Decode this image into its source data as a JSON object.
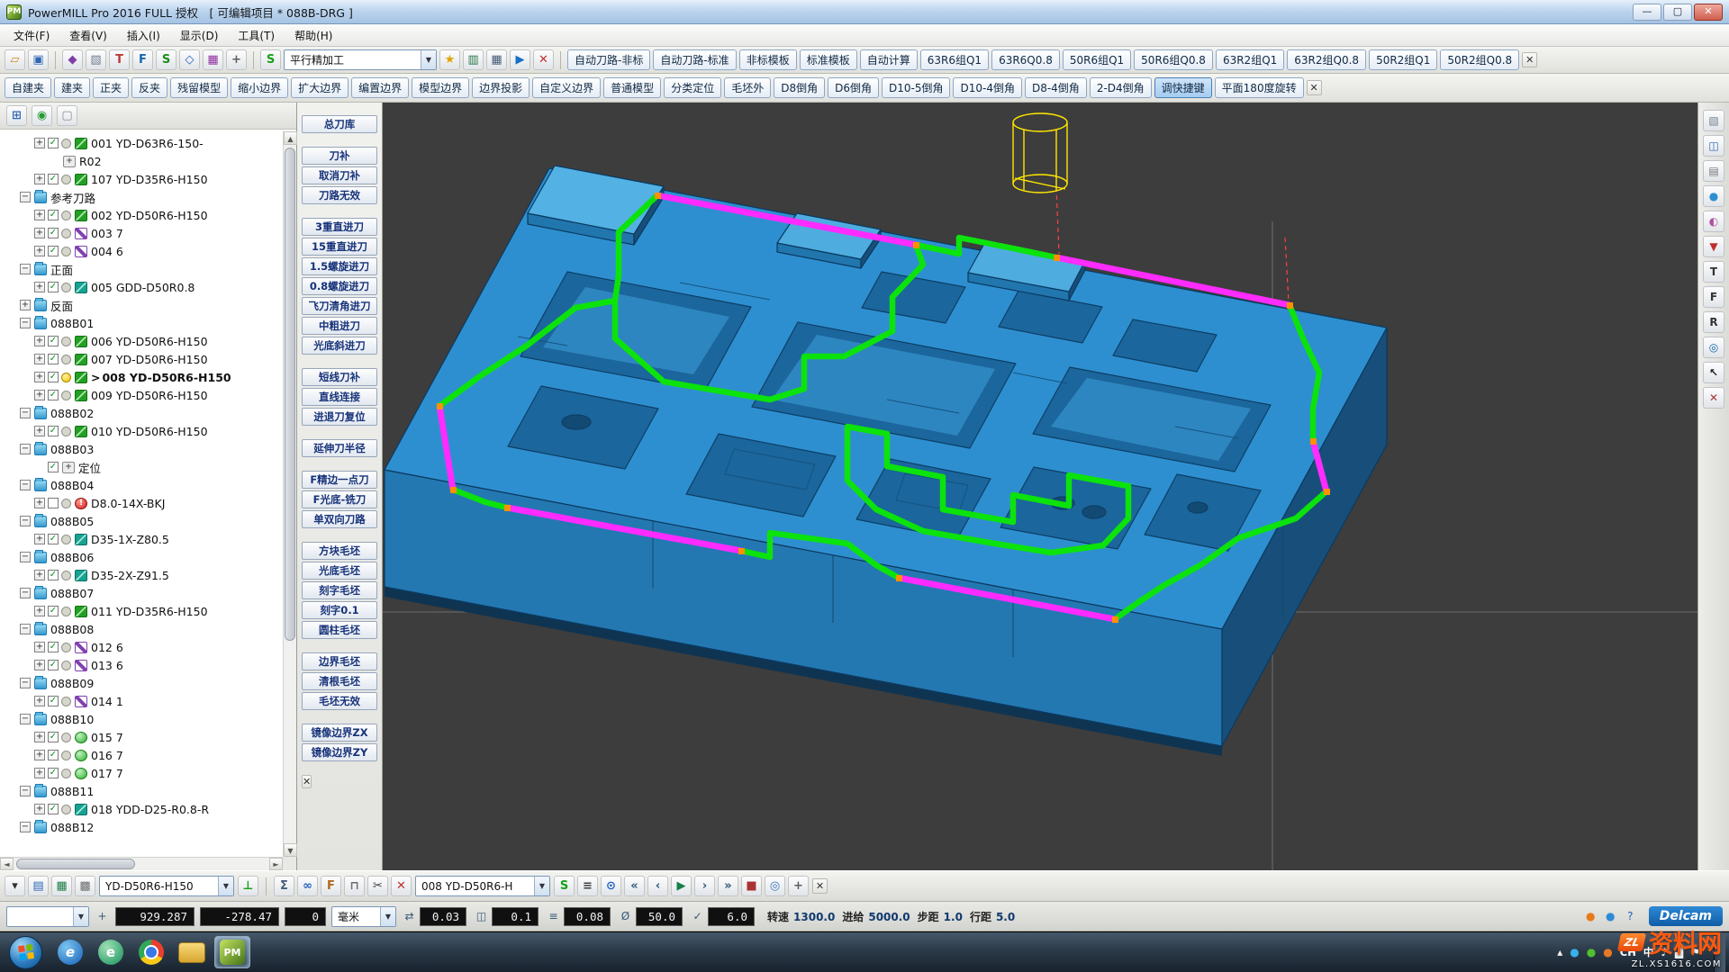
{
  "window": {
    "title": "PowerMILL Pro 2016 FULL 授权　[ 可编辑项目 * 088B-DRG ]",
    "app_badge": "PM",
    "min": "—",
    "max": "▢",
    "close": "✕"
  },
  "menu": {
    "items": [
      "文件(F)",
      "查看(V)",
      "插入(I)",
      "显示(D)",
      "工具(T)",
      "帮助(H)"
    ]
  },
  "toolbar1": {
    "icons_left": [
      {
        "name": "open-project-icon",
        "glyph": "▱",
        "color": "#d08a18"
      },
      {
        "name": "save-project-icon",
        "glyph": "▣",
        "color": "#2f67b5"
      },
      {
        "name": "sep"
      },
      {
        "name": "models-icon",
        "glyph": "◆",
        "color": "#7f3fa6"
      },
      {
        "name": "block-icon",
        "glyph": "▧",
        "color": "#6e7e8e"
      },
      {
        "name": "tool-icon",
        "glyph": "T",
        "color": "#bf3838"
      },
      {
        "name": "feeds-icon",
        "glyph": "F",
        "color": "#1767ae"
      },
      {
        "name": "toolpath-icon",
        "glyph": "S",
        "color": "#1a8f1a"
      },
      {
        "name": "boundary-icon",
        "glyph": "◇",
        "color": "#1f5fbe"
      },
      {
        "name": "pattern-icon",
        "glyph": "▦",
        "color": "#8f2f9f"
      },
      {
        "name": "workplane-icon",
        "glyph": "+",
        "color": "#5e5e5e"
      },
      {
        "name": "sep"
      },
      {
        "name": "strategy-icon",
        "glyph": "S",
        "color": "#18a018"
      }
    ],
    "strategy_combo": "平行精加工",
    "icons_right": [
      {
        "name": "wizard-icon",
        "glyph": "★",
        "color": "#e2a300"
      },
      {
        "name": "nc-program-icon",
        "glyph": "▥",
        "color": "#277546"
      },
      {
        "name": "calculator-icon",
        "glyph": "▦",
        "color": "#455d75"
      },
      {
        "name": "simulate-icon",
        "glyph": "▶",
        "color": "#176fc6"
      },
      {
        "name": "collision-check-icon",
        "glyph": "✕",
        "color": "#bf3030"
      },
      {
        "name": "sep"
      }
    ],
    "macro_buttons": [
      "自动刀路-非标",
      "自动刀路-标准",
      "非标模板",
      "标准模板",
      "自动计算",
      "63R6组Q1",
      "63R6Q0.8",
      "50R6组Q1",
      "50R6组Q0.8",
      "63R2组Q1",
      "63R2组Q0.8",
      "50R2组Q1",
      "50R2组Q0.8"
    ],
    "close": "✕"
  },
  "toolbar2": {
    "buttons": [
      "自建夹",
      "建夹",
      "正夹",
      "反夹",
      "残留模型",
      "缩小边界",
      "扩大边界",
      "编置边界",
      "模型边界",
      "边界投影",
      "自定义边界",
      "普通模型",
      "分类定位",
      "毛坯外",
      "D8倒角",
      "D6倒角",
      "D10-5倒角",
      "D10-4倒角",
      "D8-4倒角",
      "2-D4倒角",
      "调快捷键",
      "平面180度旋转"
    ],
    "active_index": 20,
    "close": "✕"
  },
  "explorer": {
    "toolbar": [
      {
        "name": "tree-view-icon",
        "glyph": "⊞",
        "color": "#2f67b5"
      },
      {
        "name": "world-icon",
        "glyph": "◉",
        "color": "#279a38"
      },
      {
        "name": "filter-icon",
        "glyph": "▢",
        "color": "#8a8a8a"
      }
    ],
    "items": [
      {
        "level": 2,
        "exp": "plus",
        "check": true,
        "bulb": "off",
        "icon": "toolpath-green",
        "label": "001 YD-D63R6-150-"
      },
      {
        "level": 3,
        "icon": "workplane",
        "label": "R02"
      },
      {
        "level": 2,
        "exp": "plus",
        "check": true,
        "bulb": "off",
        "icon": "toolpath-green",
        "label": "107 YD-D35R6-H150"
      },
      {
        "level": 1,
        "exp": "minus",
        "icon": "folder",
        "label": "参考刀路"
      },
      {
        "level": 2,
        "exp": "plus",
        "check": true,
        "bulb": "off",
        "icon": "toolpath-green",
        "label": "002 YD-D50R6-H150"
      },
      {
        "level": 2,
        "exp": "plus",
        "check": true,
        "bulb": "off",
        "icon": "pattern",
        "label": "003 7"
      },
      {
        "level": 2,
        "exp": "plus",
        "check": true,
        "bulb": "off",
        "icon": "pattern",
        "label": "004 6"
      },
      {
        "level": 1,
        "exp": "minus",
        "icon": "folder",
        "label": "正面"
      },
      {
        "level": 2,
        "exp": "plus",
        "check": true,
        "bulb": "off",
        "icon": "toolpath-teal",
        "label": "005 GDD-D50R0.8"
      },
      {
        "level": 1,
        "exp": "plus",
        "icon": "folder",
        "label": "反面"
      },
      {
        "level": 1,
        "exp": "minus",
        "icon": "folder",
        "label": "088B01"
      },
      {
        "level": 2,
        "exp": "plus",
        "check": true,
        "bulb": "off",
        "icon": "toolpath-green",
        "label": "006 YD-D50R6-H150"
      },
      {
        "level": 2,
        "exp": "plus",
        "check": true,
        "bulb": "off",
        "icon": "toolpath-green",
        "label": "007 YD-D50R6-H150"
      },
      {
        "level": 2,
        "exp": "plus",
        "check": true,
        "bulb": "on",
        "icon": "toolpath-green",
        "label": "008 YD-D50R6-H150",
        "bold": true,
        "prefix": ">"
      },
      {
        "level": 2,
        "exp": "plus",
        "check": true,
        "bulb": "off",
        "icon": "toolpath-green",
        "label": "009 YD-D50R6-H150"
      },
      {
        "level": 1,
        "exp": "minus",
        "icon": "folder",
        "label": "088B02"
      },
      {
        "level": 2,
        "exp": "plus",
        "check": true,
        "bulb": "off",
        "icon": "toolpath-green",
        "label": "010 YD-D50R6-H150"
      },
      {
        "level": 1,
        "exp": "minus",
        "icon": "folder",
        "label": "088B03"
      },
      {
        "level": 2,
        "check": true,
        "icon": "workplane",
        "label": "定位"
      },
      {
        "level": 1,
        "exp": "minus",
        "icon": "folder",
        "label": "088B04"
      },
      {
        "level": 2,
        "exp": "plus",
        "check": false,
        "bulb": "off",
        "icon": "error",
        "label": "D8.0-14X-BKJ"
      },
      {
        "level": 1,
        "exp": "minus",
        "icon": "folder",
        "label": "088B05"
      },
      {
        "level": 2,
        "exp": "plus",
        "check": true,
        "bulb": "off",
        "icon": "toolpath-teal",
        "label": "D35-1X-Z80.5"
      },
      {
        "level": 1,
        "exp": "minus",
        "icon": "folder",
        "label": "088B06"
      },
      {
        "level": 2,
        "exp": "plus",
        "check": true,
        "bulb": "off",
        "icon": "toolpath-teal",
        "label": "D35-2X-Z91.5"
      },
      {
        "level": 1,
        "exp": "minus",
        "icon": "folder",
        "label": "088B07"
      },
      {
        "level": 2,
        "exp": "plus",
        "check": true,
        "bulb": "off",
        "icon": "toolpath-green",
        "label": "011 YD-D35R6-H150"
      },
      {
        "level": 1,
        "exp": "minus",
        "icon": "folder",
        "label": "088B08"
      },
      {
        "level": 2,
        "exp": "plus",
        "check": true,
        "bulb": "off",
        "icon": "pattern",
        "label": "012 6"
      },
      {
        "level": 2,
        "exp": "plus",
        "check": true,
        "bulb": "off",
        "icon": "pattern",
        "label": "013 6"
      },
      {
        "level": 1,
        "exp": "minus",
        "icon": "folder",
        "label": "088B09"
      },
      {
        "level": 2,
        "exp": "plus",
        "check": true,
        "bulb": "off",
        "icon": "pattern",
        "label": "014 1"
      },
      {
        "level": 1,
        "exp": "minus",
        "icon": "folder",
        "label": "088B10"
      },
      {
        "level": 2,
        "exp": "plus",
        "check": true,
        "bulb": "off",
        "icon": "boundary",
        "label": "015 7"
      },
      {
        "level": 2,
        "exp": "plus",
        "check": true,
        "bulb": "off",
        "icon": "boundary",
        "label": "016 7"
      },
      {
        "level": 2,
        "exp": "plus",
        "check": true,
        "bulb": "off",
        "icon": "boundary",
        "label": "017 7"
      },
      {
        "level": 1,
        "exp": "minus",
        "icon": "folder",
        "label": "088B11"
      },
      {
        "level": 2,
        "exp": "plus",
        "check": true,
        "bulb": "off",
        "icon": "toolpath-teal",
        "label": "018 YDD-D25-R0.8-R"
      },
      {
        "level": 1,
        "exp": "minus",
        "icon": "folder",
        "label": "088B12"
      }
    ]
  },
  "macro_panel": {
    "groups": [
      [
        "总刀库"
      ],
      [
        "刀补",
        "取消刀补",
        "刀路无效"
      ],
      [
        "3重直进刀",
        "15重直进刀",
        "1.5螺旋进刀",
        "0.8螺旋进刀",
        "飞刀清角进刀",
        "中粗进刀",
        "光底斜进刀"
      ],
      [
        "短线刀补",
        "直线连接",
        "进退刀复位"
      ],
      [
        "延伸刀半径"
      ],
      [
        "F精边一点刀",
        "F光底-铣刀",
        "单双向刀路"
      ],
      [
        "方块毛坯",
        "光底毛坯",
        "刻字毛坯",
        "刻字0.1",
        "圆柱毛坯"
      ],
      [
        "边界毛坯",
        "清根毛坯",
        "毛坯无效"
      ],
      [
        "镜像边界ZX",
        "镜像边界ZY"
      ]
    ],
    "close": "✕"
  },
  "right_toolbar": {
    "icons": [
      {
        "name": "block-view-icon",
        "glyph": "▧",
        "color": "#6e7e8e"
      },
      {
        "name": "iso-view-icon",
        "glyph": "◫",
        "color": "#2f67b5"
      },
      {
        "name": "wireframe-view-icon",
        "glyph": "▤",
        "color": "#777"
      },
      {
        "name": "shaded-view-icon",
        "glyph": "●",
        "color": "#2e8fd0"
      },
      {
        "name": "rainbow-view-icon",
        "glyph": "◐",
        "color": "#b04fa0"
      },
      {
        "name": "gouge-view-icon",
        "glyph": "▼",
        "color": "#bf3030"
      },
      {
        "name": "top-view-icon",
        "glyph": "T",
        "color": "#333"
      },
      {
        "name": "front-view-icon",
        "glyph": "F",
        "color": "#333"
      },
      {
        "name": "right-view-icon",
        "glyph": "R",
        "color": "#333"
      },
      {
        "name": "zoom-fit-icon",
        "glyph": "◎",
        "color": "#1767ae"
      },
      {
        "name": "cursor-icon",
        "glyph": "↖",
        "color": "#222"
      },
      {
        "name": "close-right-toolbar-icon",
        "glyph": "✕",
        "color": "#a33"
      }
    ]
  },
  "bottom_toolbar": {
    "left_icons": [
      {
        "name": "display-options-icon",
        "glyph": "▾",
        "color": "#303030"
      },
      {
        "name": "levels-icon",
        "glyph": "▤",
        "color": "#2f67b5"
      },
      {
        "name": "named-views-icon",
        "glyph": "▦",
        "color": "#1f7f48"
      },
      {
        "name": "grid-icon",
        "glyph": "▩",
        "color": "#6e6e6e"
      }
    ],
    "tool_combo": "YD-D50R6-H150",
    "tool_icons": [
      {
        "name": "active-tool-icon",
        "glyph": "⊥",
        "color": "#18a018"
      }
    ],
    "mid_icons": [
      {
        "name": "toolpath-stats-icon",
        "glyph": "Σ",
        "color": "#455d75"
      },
      {
        "name": "leads-links-icon",
        "glyph": "∞",
        "color": "#1f5fbe"
      },
      {
        "name": "feeds-speeds-icon",
        "glyph": "F",
        "color": "#b06818"
      },
      {
        "name": "holder-icon",
        "glyph": "⊓",
        "color": "#6e6e6e"
      },
      {
        "name": "cut-icon",
        "glyph": "✂",
        "color": "#3e3e3e"
      },
      {
        "name": "delete-icon",
        "glyph": "✕",
        "color": "#bf3030"
      }
    ],
    "toolpath_combo": "008 YD-D50R6-H",
    "right_icons": [
      {
        "name": "strategy2-icon",
        "glyph": "S",
        "color": "#18a018"
      },
      {
        "name": "batch-icon",
        "glyph": "≡",
        "color": "#3e3e3e"
      },
      {
        "name": "recalc-icon",
        "glyph": "⊙",
        "color": "#1f5fbe"
      },
      {
        "name": "sim-rewind-icon",
        "glyph": "«",
        "color": "#2e5878"
      },
      {
        "name": "sim-back-icon",
        "glyph": "‹",
        "color": "#2e5878"
      },
      {
        "name": "sim-play-icon",
        "glyph": "▶",
        "color": "#167f46"
      },
      {
        "name": "sim-forward-icon",
        "glyph": "›",
        "color": "#2e5878"
      },
      {
        "name": "sim-ff-icon",
        "glyph": "»",
        "color": "#2e5878"
      },
      {
        "name": "sim-stop-icon",
        "glyph": "■",
        "color": "#a33"
      },
      {
        "name": "viewmill-icon",
        "glyph": "◎",
        "color": "#3675be"
      },
      {
        "name": "origin-icon",
        "glyph": "+",
        "color": "#5e5e5e"
      }
    ],
    "close": "✕"
  },
  "status_bar": {
    "x": "929.287",
    "y": "-278.47",
    "z": "0",
    "units": "毫米",
    "fields": [
      {
        "name": "tolerance",
        "icon": "⇄",
        "value": "0.03"
      },
      {
        "name": "thickness",
        "icon": "◫",
        "value": "0.1"
      },
      {
        "name": "stepover",
        "icon": "≡",
        "value": "0.08"
      },
      {
        "name": "tool-diameter",
        "icon": "Ø",
        "value": "50.0"
      },
      {
        "name": "tip-radius",
        "icon": "✓",
        "value": "6.0"
      }
    ],
    "params": [
      {
        "label": "转速",
        "value": "1300.0"
      },
      {
        "label": "进给",
        "value": "5000.0"
      },
      {
        "label": "步距",
        "value": "1.0"
      },
      {
        "label": "行距",
        "value": "5.0"
      }
    ],
    "right_icons": [
      {
        "name": "pmuser-icon",
        "glyph": "●",
        "color": "#e87818"
      },
      {
        "name": "connect-icon",
        "glyph": "●",
        "color": "#2f8ad6"
      },
      {
        "name": "help-icon",
        "glyph": "?",
        "color": "#1f5fbe"
      }
    ],
    "brand": "Delcam"
  },
  "taskbar": {
    "apps": [
      {
        "name": "internet-explorer-icon",
        "label": "e"
      },
      {
        "name": "browser-icon",
        "label": "e"
      },
      {
        "name": "chrome-icon",
        "label": ""
      },
      {
        "name": "file-explorer-icon",
        "label": ""
      },
      {
        "name": "powermill-taskbar-icon",
        "label": "PM",
        "active": true
      }
    ],
    "tray_icons": [
      {
        "name": "hidden-icons-chevron",
        "glyph": "▴",
        "color": "#f0f0f0"
      },
      {
        "name": "im-tray-icon",
        "glyph": "●",
        "color": "#38b0e8"
      },
      {
        "name": "security-tray-icon",
        "glyph": "●",
        "color": "#50c030"
      },
      {
        "name": "update-tray-icon",
        "glyph": "●",
        "color": "#e87828"
      },
      {
        "name": "language-indicator",
        "glyph": "CH",
        "color": "#ffffff",
        "text": true
      },
      {
        "name": "ime-indicator",
        "glyph": "中",
        "color": "#ffffff",
        "text": true
      },
      {
        "name": "volume-tray-icon",
        "glyph": "♪",
        "color": "#f0f0f0"
      },
      {
        "name": "network-tray-icon",
        "glyph": "▟",
        "color": "#f0f0f0"
      },
      {
        "name": "flag-tray-icon",
        "glyph": "⚑",
        "color": "#f0f0f0"
      }
    ]
  },
  "watermark": {
    "logo": "ZL",
    "title": "资料网",
    "subtitle": "ZL.XS1616.COM"
  },
  "viewport": {
    "background": "#3d3d3d",
    "model_color": "#2e8fd0",
    "toolpath_finish_color": "#ff2bff",
    "toolpath_link_color": "#0ce20c",
    "node_color": "#ff9000",
    "tool_color": "#ffe800"
  }
}
